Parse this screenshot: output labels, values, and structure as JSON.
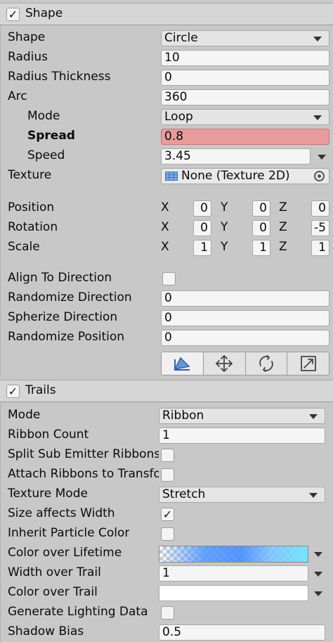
{
  "shape": {
    "header": "Shape",
    "enabled": true,
    "shape_label": "Shape",
    "shape_value": "Circle",
    "radius_label": "Radius",
    "radius_value": "10",
    "thickness_label": "Radius Thickness",
    "thickness_value": "0",
    "arc_label": "Arc",
    "arc_value": "360",
    "mode_label": "Mode",
    "mode_value": "Loop",
    "spread_label": "Spread",
    "spread_value": "0.8",
    "speed_label": "Speed",
    "speed_value": "3.45",
    "texture_label": "Texture",
    "texture_value": "None (Texture 2D)",
    "position": {
      "label": "Position",
      "x": "0",
      "y": "0",
      "z": "0"
    },
    "rotation": {
      "label": "Rotation",
      "x": "0",
      "y": "0",
      "z": "-5"
    },
    "scale": {
      "label": "Scale",
      "x": "1",
      "y": "1",
      "z": "1"
    },
    "axis_x": "X",
    "axis_y": "Y",
    "axis_z": "Z",
    "align_label": "Align To Direction",
    "align_checked": false,
    "randomize_dir_label": "Randomize Direction",
    "randomize_dir_value": "0",
    "spherize_label": "Spherize Direction",
    "spherize_value": "0",
    "randomize_pos_label": "Randomize Position",
    "randomize_pos_value": "0",
    "tools": [
      "edit-shape-icon",
      "move-icon",
      "rotate-icon",
      "scale-icon"
    ]
  },
  "trails": {
    "header": "Trails",
    "enabled": true,
    "mode_label": "Mode",
    "mode_value": "Ribbon",
    "ribbon_count_label": "Ribbon Count",
    "ribbon_count_value": "1",
    "split_label": "Split Sub Emitter Ribbons",
    "attach_label": "Attach Ribbons to Transform",
    "texture_mode_label": "Texture Mode",
    "texture_mode_value": "Stretch",
    "size_width_label": "Size affects Width",
    "size_width_checked": "✓",
    "inherit_color_label": "Inherit Particle Color",
    "color_lifetime_label": "Color over Lifetime",
    "width_trail_label": "Width over Trail",
    "width_trail_value": "1",
    "color_trail_label": "Color over Trail",
    "lighting_label": "Generate Lighting Data",
    "shadow_bias_label": "Shadow Bias",
    "shadow_bias_value": "0.5"
  },
  "colors": {
    "spread_highlight": "#e99c9c",
    "background": "#c8c8c8",
    "header": "#d6d6d6"
  }
}
